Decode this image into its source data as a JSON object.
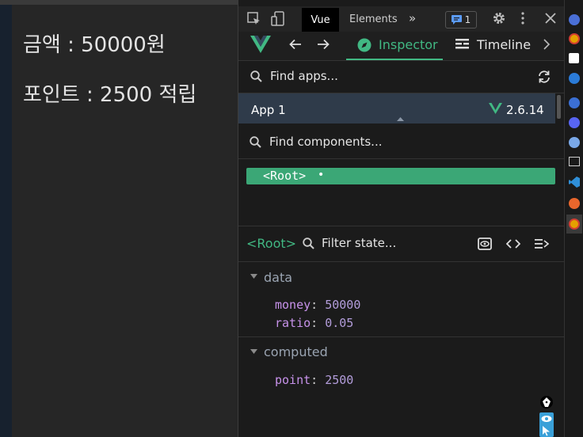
{
  "page": {
    "amount_line": "금액 : 50000원",
    "point_line": "포인트 : 2500 적립"
  },
  "devtools": {
    "tabs": {
      "vue": "Vue",
      "elements": "Elements",
      "more": "»",
      "issues_count": "1"
    },
    "vue_toolbar": {
      "inspector": "Inspector",
      "timeline": "Timeline"
    },
    "find_apps_placeholder": "Find apps...",
    "app": {
      "name": "App 1",
      "version": "2.6.14"
    },
    "find_components_placeholder": "Find components...",
    "tree": {
      "root_label": "<Root>",
      "dot": "•"
    },
    "state": {
      "selected": "<Root>",
      "filter_placeholder": "Filter state...",
      "data_title": "data",
      "computed_title": "computed",
      "data": [
        {
          "key": "money",
          "value": "50000"
        },
        {
          "key": "ratio",
          "value": "0.05"
        }
      ],
      "computed": [
        {
          "key": "point",
          "value": "2500"
        }
      ]
    }
  },
  "colors": {
    "vue_green": "#41b883",
    "app_row_bg": "#2f3b4a",
    "selected_node_bg": "#3ba776"
  }
}
